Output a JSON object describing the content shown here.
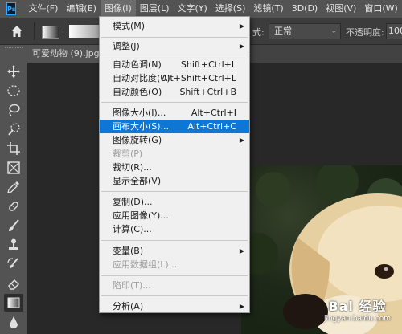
{
  "menubar": {
    "logo": "Ps",
    "items": [
      "文件(F)",
      "编辑(E)",
      "图像(I)",
      "图层(L)",
      "文字(Y)",
      "选择(S)",
      "滤镜(T)",
      "3D(D)",
      "视图(V)",
      "窗口(W)",
      "帮"
    ]
  },
  "options": {
    "mode_label": "式:",
    "mode_value": "正常",
    "opacity_label": "不透明度:",
    "opacity_value": "100"
  },
  "document": {
    "tab_title": "可爱动物 (9).jpg @"
  },
  "image_menu": {
    "items": [
      {
        "label": "模式(M)",
        "shortcut": "",
        "submenu": true,
        "disabled": false
      },
      {
        "label": "调整(J)",
        "shortcut": "",
        "submenu": true,
        "disabled": false
      },
      {
        "label": "自动色调(N)",
        "shortcut": "Shift+Ctrl+L",
        "submenu": false,
        "disabled": false
      },
      {
        "label": "自动对比度(U)",
        "shortcut": "Alt+Shift+Ctrl+L",
        "submenu": false,
        "disabled": false
      },
      {
        "label": "自动颜色(O)",
        "shortcut": "Shift+Ctrl+B",
        "submenu": false,
        "disabled": false
      },
      {
        "label": "图像大小(I)...",
        "shortcut": "Alt+Ctrl+I",
        "submenu": false,
        "disabled": false
      },
      {
        "label": "画布大小(S)...",
        "shortcut": "Alt+Ctrl+C",
        "submenu": false,
        "disabled": false,
        "highlighted": true
      },
      {
        "label": "图像旋转(G)",
        "shortcut": "",
        "submenu": true,
        "disabled": false
      },
      {
        "label": "裁剪(P)",
        "shortcut": "",
        "submenu": false,
        "disabled": true
      },
      {
        "label": "裁切(R)...",
        "shortcut": "",
        "submenu": false,
        "disabled": false
      },
      {
        "label": "显示全部(V)",
        "shortcut": "",
        "submenu": false,
        "disabled": false
      },
      {
        "label": "复制(D)...",
        "shortcut": "",
        "submenu": false,
        "disabled": false
      },
      {
        "label": "应用图像(Y)...",
        "shortcut": "",
        "submenu": false,
        "disabled": false
      },
      {
        "label": "计算(C)...",
        "shortcut": "",
        "submenu": false,
        "disabled": false
      },
      {
        "label": "变量(B)",
        "shortcut": "",
        "submenu": true,
        "disabled": false
      },
      {
        "label": "应用数据组(L)...",
        "shortcut": "",
        "submenu": false,
        "disabled": true
      },
      {
        "label": "陷印(T)...",
        "shortcut": "",
        "submenu": false,
        "disabled": true
      },
      {
        "label": "分析(A)",
        "shortcut": "",
        "submenu": true,
        "disabled": false
      }
    ]
  },
  "watermark": {
    "brand": "Bai 经验",
    "url": "jingyan.baidu.com"
  },
  "colors": {
    "menu_highlight": "#0e77d6",
    "menubar_bg": "#535353",
    "options_bg": "#3c3c3c",
    "canvas_bg": "#282828"
  }
}
